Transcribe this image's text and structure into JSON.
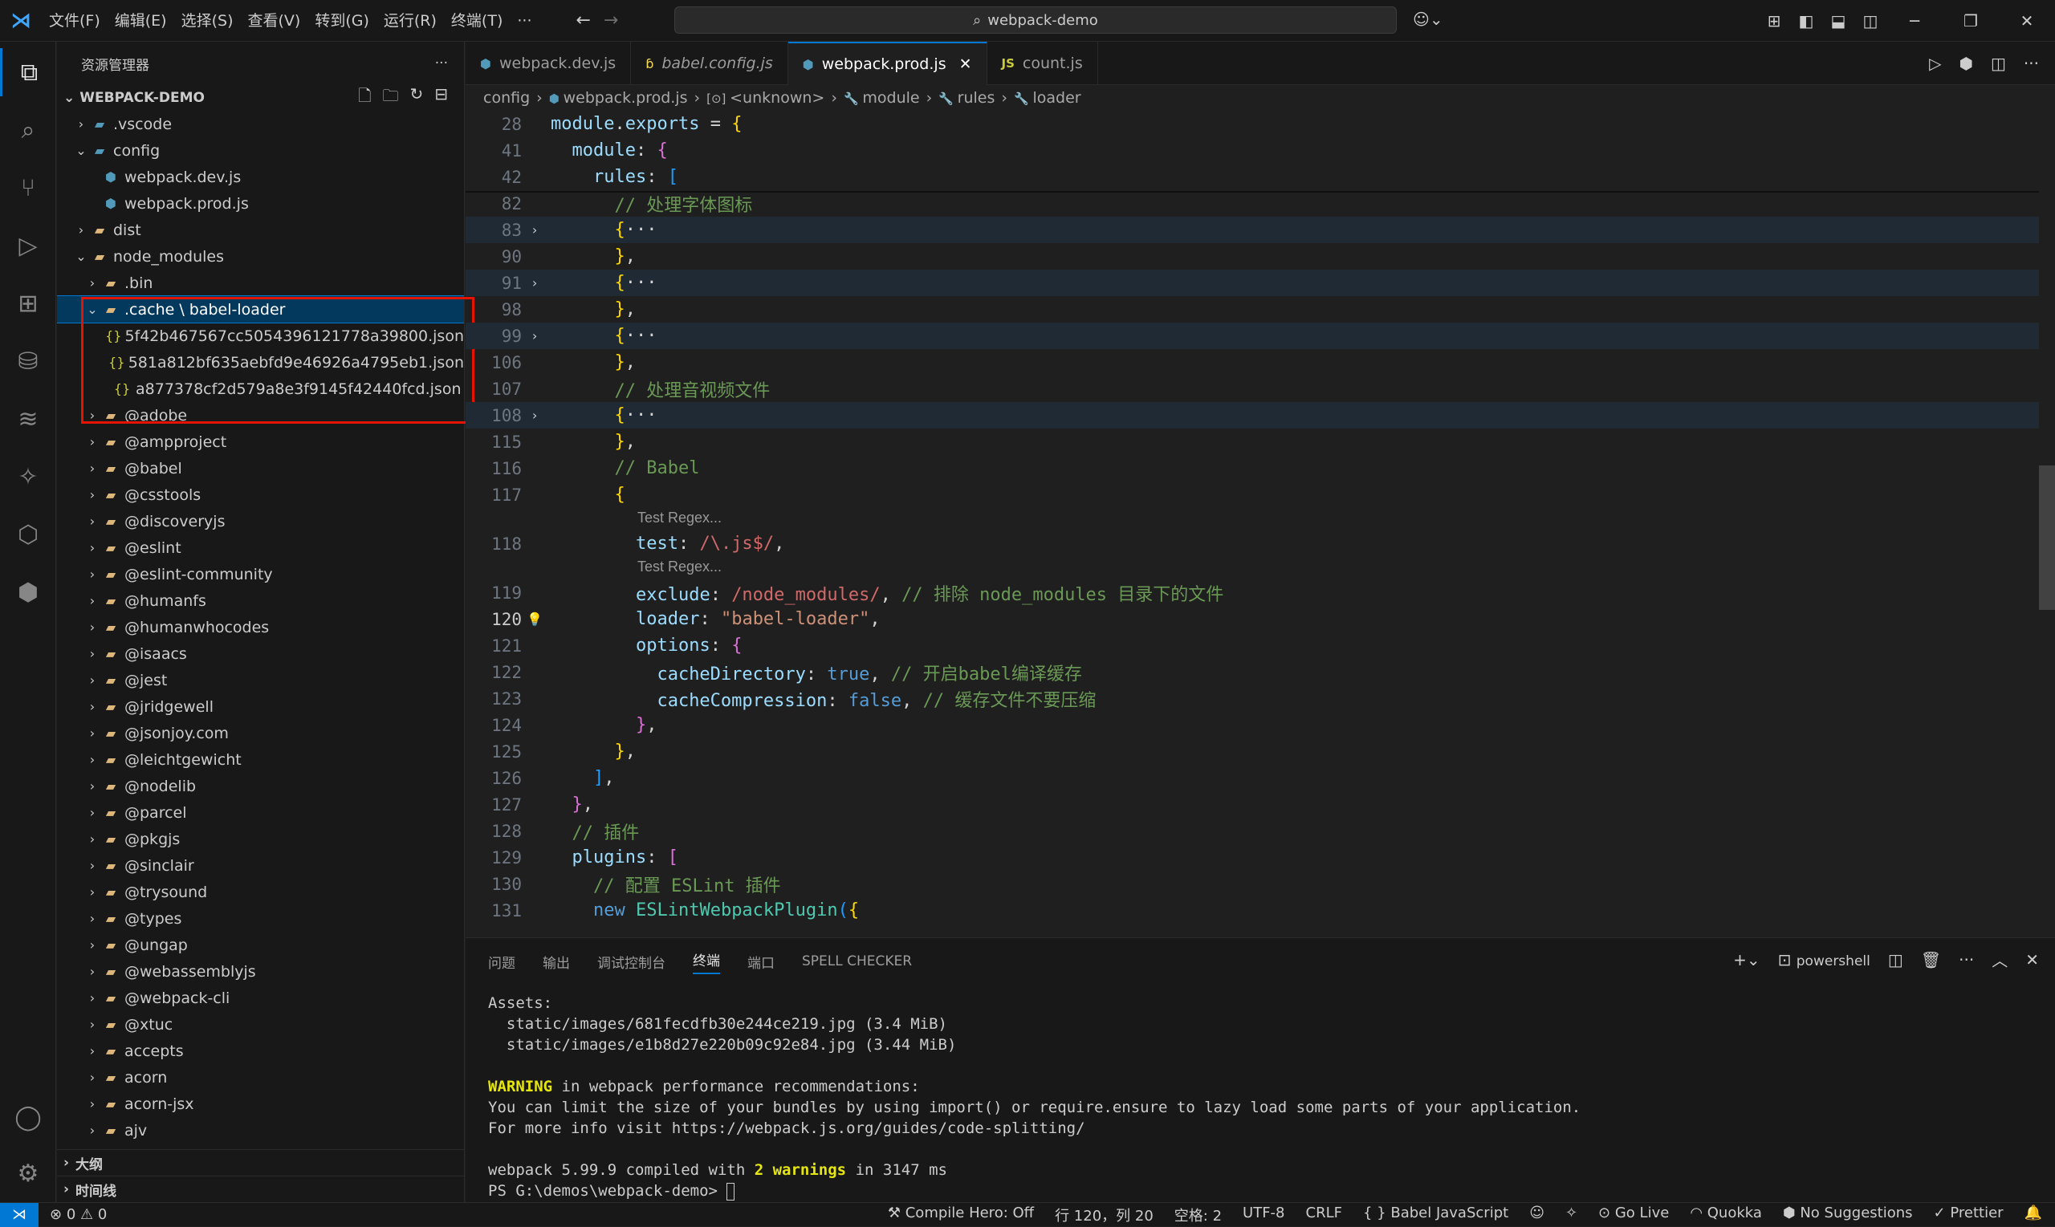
{
  "titlebar": {
    "menu": [
      "文件(F)",
      "编辑(E)",
      "选择(S)",
      "查看(V)",
      "转到(G)",
      "运行(R)",
      "终端(T)",
      "···"
    ],
    "search": "webpack-demo"
  },
  "explorer": {
    "header": "资源管理器",
    "root": "WEBPACK-DEMO",
    "items": [
      {
        "label": ".vscode",
        "depth": 0,
        "chev": "›",
        "icon": "folder-vscode-icon"
      },
      {
        "label": "config",
        "depth": 0,
        "chev": "⌄",
        "icon": "folder-config-icon"
      },
      {
        "label": "webpack.dev.js",
        "depth": 1,
        "chev": "",
        "icon": "js-file-icon"
      },
      {
        "label": "webpack.prod.js",
        "depth": 1,
        "chev": "",
        "icon": "js-file-icon"
      },
      {
        "label": "dist",
        "depth": 0,
        "chev": "›",
        "icon": "folder-icon"
      },
      {
        "label": "node_modules",
        "depth": 0,
        "chev": "⌄",
        "icon": "folder-node-icon"
      },
      {
        "label": ".bin",
        "depth": 1,
        "chev": "›",
        "icon": "folder-bin-icon"
      },
      {
        "label": ".cache \\ babel-loader",
        "depth": 1,
        "chev": "⌄",
        "icon": "folder-icon",
        "selected": true
      },
      {
        "label": "5f42b467567cc5054396121778a39800.json",
        "depth": 2,
        "chev": "",
        "icon": "json-file-icon"
      },
      {
        "label": "581a812bf635aebfd9e46926a4795eb1.json",
        "depth": 2,
        "chev": "",
        "icon": "json-file-icon"
      },
      {
        "label": "a877378cf2d579a8e3f9145f42440fcd.json",
        "depth": 2,
        "chev": "",
        "icon": "json-file-icon"
      },
      {
        "label": "@adobe",
        "depth": 1,
        "chev": "›",
        "icon": "folder-icon"
      },
      {
        "label": "@ampproject",
        "depth": 1,
        "chev": "›",
        "icon": "folder-icon"
      },
      {
        "label": "@babel",
        "depth": 1,
        "chev": "›",
        "icon": "folder-icon"
      },
      {
        "label": "@csstools",
        "depth": 1,
        "chev": "›",
        "icon": "folder-icon"
      },
      {
        "label": "@discoveryjs",
        "depth": 1,
        "chev": "›",
        "icon": "folder-icon"
      },
      {
        "label": "@eslint",
        "depth": 1,
        "chev": "›",
        "icon": "folder-icon"
      },
      {
        "label": "@eslint-community",
        "depth": 1,
        "chev": "›",
        "icon": "folder-icon"
      },
      {
        "label": "@humanfs",
        "depth": 1,
        "chev": "›",
        "icon": "folder-icon"
      },
      {
        "label": "@humanwhocodes",
        "depth": 1,
        "chev": "›",
        "icon": "folder-icon"
      },
      {
        "label": "@isaacs",
        "depth": 1,
        "chev": "›",
        "icon": "folder-icon"
      },
      {
        "label": "@jest",
        "depth": 1,
        "chev": "›",
        "icon": "folder-icon"
      },
      {
        "label": "@jridgewell",
        "depth": 1,
        "chev": "›",
        "icon": "folder-icon"
      },
      {
        "label": "@jsonjoy.com",
        "depth": 1,
        "chev": "›",
        "icon": "folder-icon"
      },
      {
        "label": "@leichtgewicht",
        "depth": 1,
        "chev": "›",
        "icon": "folder-icon"
      },
      {
        "label": "@nodelib",
        "depth": 1,
        "chev": "›",
        "icon": "folder-icon"
      },
      {
        "label": "@parcel",
        "depth": 1,
        "chev": "›",
        "icon": "folder-icon"
      },
      {
        "label": "@pkgjs",
        "depth": 1,
        "chev": "›",
        "icon": "folder-icon"
      },
      {
        "label": "@sinclair",
        "depth": 1,
        "chev": "›",
        "icon": "folder-icon"
      },
      {
        "label": "@trysound",
        "depth": 1,
        "chev": "›",
        "icon": "folder-icon"
      },
      {
        "label": "@types",
        "depth": 1,
        "chev": "›",
        "icon": "folder-types-icon"
      },
      {
        "label": "@ungap",
        "depth": 1,
        "chev": "›",
        "icon": "folder-icon"
      },
      {
        "label": "@webassemblyjs",
        "depth": 1,
        "chev": "›",
        "icon": "folder-icon"
      },
      {
        "label": "@webpack-cli",
        "depth": 1,
        "chev": "›",
        "icon": "folder-icon"
      },
      {
        "label": "@xtuc",
        "depth": 1,
        "chev": "›",
        "icon": "folder-icon"
      },
      {
        "label": "accepts",
        "depth": 1,
        "chev": "›",
        "icon": "folder-icon"
      },
      {
        "label": "acorn",
        "depth": 1,
        "chev": "›",
        "icon": "folder-icon"
      },
      {
        "label": "acorn-jsx",
        "depth": 1,
        "chev": "›",
        "icon": "folder-icon"
      },
      {
        "label": "ajv",
        "depth": 1,
        "chev": "›",
        "icon": "folder-icon"
      }
    ],
    "outline": "大纲",
    "timeline": "时间线"
  },
  "tabs": [
    {
      "label": "webpack.dev.js",
      "icon": "js-file-icon",
      "italic": false,
      "active": false
    },
    {
      "label": "babel.config.js",
      "icon": "babel-file-icon",
      "italic": true,
      "active": false
    },
    {
      "label": "webpack.prod.js",
      "icon": "js-file-icon",
      "italic": false,
      "active": true
    },
    {
      "label": "count.js",
      "icon": "js-icon",
      "italic": false,
      "active": false
    }
  ],
  "tab_close": "✕",
  "breadcrumb": [
    "config",
    "webpack.prod.js",
    "<unknown>",
    "module",
    "rules",
    "loader"
  ],
  "code": {
    "lines": [
      {
        "n": "28",
        "html": "<span class='v'>module</span><span class='p'>.</span><span class='v'>exports</span><span class='p'> = </span><span class='br1'>{</span>"
      },
      {
        "n": "41",
        "html": "  <span class='v'>module</span><span class='p'>: </span><span class='br2'>{</span>"
      },
      {
        "n": "42",
        "html": "    <span class='v'>rules</span><span class='p'>: </span><span class='br3'>[</span>"
      },
      {
        "n": "82",
        "html": "      <span class='c'>// 处理字体图标</span>"
      },
      {
        "n": "83",
        "fold": "›",
        "hl": true,
        "html": "      <span class='br1'>{</span><span class='p'>···</span>"
      },
      {
        "n": "90",
        "html": "      <span class='br1'>}</span><span class='p'>,</span>"
      },
      {
        "n": "91",
        "fold": "›",
        "hl": true,
        "html": "      <span class='br1'>{</span><span class='p'>···</span>"
      },
      {
        "n": "98",
        "html": "      <span class='br1'>}</span><span class='p'>,</span>"
      },
      {
        "n": "99",
        "fold": "›",
        "hl": true,
        "html": "      <span class='br1'>{</span><span class='p'>···</span>"
      },
      {
        "n": "106",
        "html": "      <span class='br1'>}</span><span class='p'>,</span>"
      },
      {
        "n": "107",
        "html": "      <span class='c'>// 处理音视频文件</span>"
      },
      {
        "n": "108",
        "fold": "›",
        "hl": true,
        "html": "      <span class='br1'>{</span><span class='p'>···</span>"
      },
      {
        "n": "115",
        "html": "      <span class='br1'>}</span><span class='p'>,</span>"
      },
      {
        "n": "116",
        "html": "      <span class='c'>// Babel</span>"
      },
      {
        "n": "117",
        "html": "      <span class='br1'>{</span>"
      },
      {
        "n": "118",
        "lens": "Test Regex...",
        "html": "        <span class='v'>test</span><span class='p'>: </span><span class='r'>/\\.js$/</span><span class='p'>,</span>"
      },
      {
        "n": "119",
        "lens": "Test Regex...",
        "html": "        <span class='v'>exclude</span><span class='p'>: </span><span class='r'>/node_modules/</span><span class='p'>, </span><span class='c'>// 排除 node_modules 目录下的文件</span>"
      },
      {
        "n": "120",
        "cur": true,
        "html": "        <span class='v'>loader</span><span class='p'>: </span><span class='s'>\"babel-loader\"</span><span class='p'>,</span>"
      },
      {
        "n": "121",
        "html": "        <span class='v'>options</span><span class='p'>: </span><span class='br2'>{</span>"
      },
      {
        "n": "122",
        "html": "          <span class='v'>cacheDirectory</span><span class='p'>: </span><span class='b'>true</span><span class='p'>, </span><span class='c'>// 开启babel编译缓存</span>"
      },
      {
        "n": "123",
        "html": "          <span class='v'>cacheCompression</span><span class='p'>: </span><span class='b'>false</span><span class='p'>, </span><span class='c'>// 缓存文件不要压缩</span>"
      },
      {
        "n": "124",
        "html": "        <span class='br2'>}</span><span class='p'>,</span>"
      },
      {
        "n": "125",
        "html": "      <span class='br1'>}</span><span class='p'>,</span>"
      },
      {
        "n": "126",
        "html": "    <span class='br3'>]</span><span class='p'>,</span>"
      },
      {
        "n": "127",
        "html": "  <span class='br2'>}</span><span class='p'>,</span>"
      },
      {
        "n": "128",
        "html": "  <span class='c'>// 插件</span>"
      },
      {
        "n": "129",
        "html": "  <span class='v'>plugins</span><span class='p'>: </span><span class='br2'>[</span>"
      },
      {
        "n": "130",
        "html": "    <span class='c'>// 配置 ESLint 插件</span>"
      },
      {
        "n": "131",
        "html": "    <span class='k'>new</span><span class='p'> </span><span class='cl'>ESLintWebpackPlugin</span><span class='br3'>(</span><span class='br1'>{</span>"
      }
    ]
  },
  "panel": {
    "tabs": [
      "问题",
      "输出",
      "调试控制台",
      "终端",
      "端口",
      "SPELL CHECKER"
    ],
    "active_tab": "终端",
    "shell": "powershell",
    "terminal_lines": [
      {
        "type": "plain",
        "text": "Assets:"
      },
      {
        "type": "plain",
        "text": "  static/images/681fecdfb30e244ce219.jpg (3.4 MiB)"
      },
      {
        "type": "plain",
        "text": "  static/images/e1b8d27e220b09c92e84.jpg (3.44 MiB)"
      },
      {
        "type": "blank",
        "text": ""
      },
      {
        "type": "warn",
        "bold": "WARNING",
        "text": " in webpack performance recommendations:"
      },
      {
        "type": "plain",
        "text": "You can limit the size of your bundles by using import() or require.ensure to lazy load some parts of your application."
      },
      {
        "type": "plain",
        "text": "For more info visit https://webpack.js.org/guides/code-splitting/"
      },
      {
        "type": "blank",
        "text": ""
      },
      {
        "type": "compiled",
        "pre": "webpack 5.99.9 compiled with ",
        "bold": "2 warnings",
        "post": " in 3147 ms"
      },
      {
        "type": "prompt",
        "text": "PS G:\\demos\\webpack-demo> "
      }
    ]
  },
  "statusbar": {
    "errors": "0",
    "warnings": "0",
    "compile_hero": "Compile Hero: Off",
    "position": "行 120，列 20",
    "spaces": "空格: 2",
    "encoding": "UTF-8",
    "eol": "CRLF",
    "language": "Babel JavaScript",
    "golive": "Go Live",
    "quokka": "Quokka",
    "suggestions": "No Suggestions",
    "prettier": "Prettier"
  }
}
